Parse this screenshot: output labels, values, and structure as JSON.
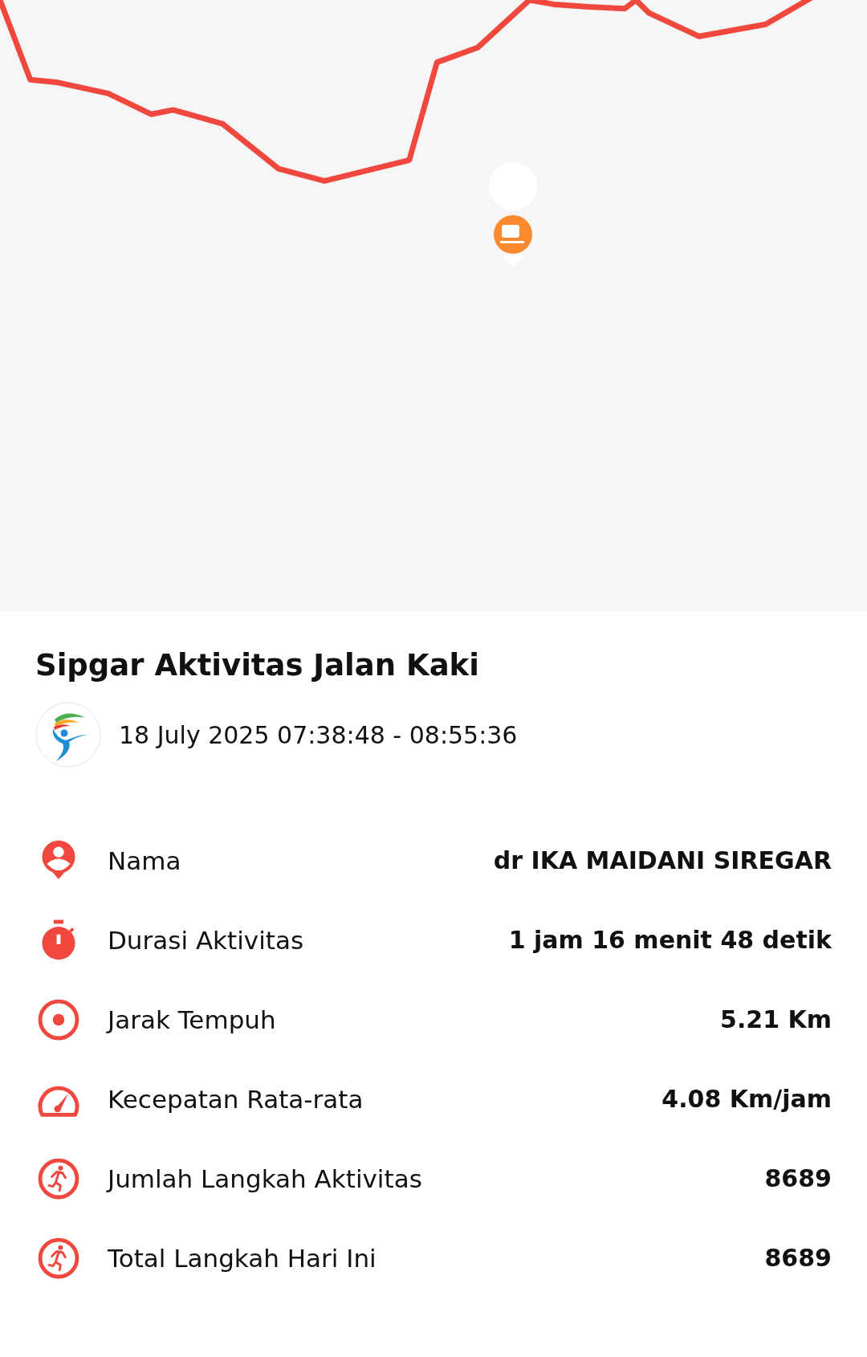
{
  "activity": {
    "title": "Sipgar Aktivitas Jalan Kaki",
    "time_range": "18 July 2025 07:38:48 - 08:55:36"
  },
  "stats": [
    {
      "label": "Nama",
      "value": "dr IKA MAIDANI SIREGAR"
    },
    {
      "label": "Durasi Aktivitas",
      "value": "1 jam 16 menit 48 detik"
    },
    {
      "label": "Jarak Tempuh",
      "value": "5.21 Km"
    },
    {
      "label": "Kecepatan Rata-rata",
      "value": "4.08 Km/jam"
    },
    {
      "label": "Jumlah Langkah Aktivitas",
      "value": "8689"
    },
    {
      "label": "Total Langkah Hari Ini",
      "value": "8689"
    }
  ]
}
